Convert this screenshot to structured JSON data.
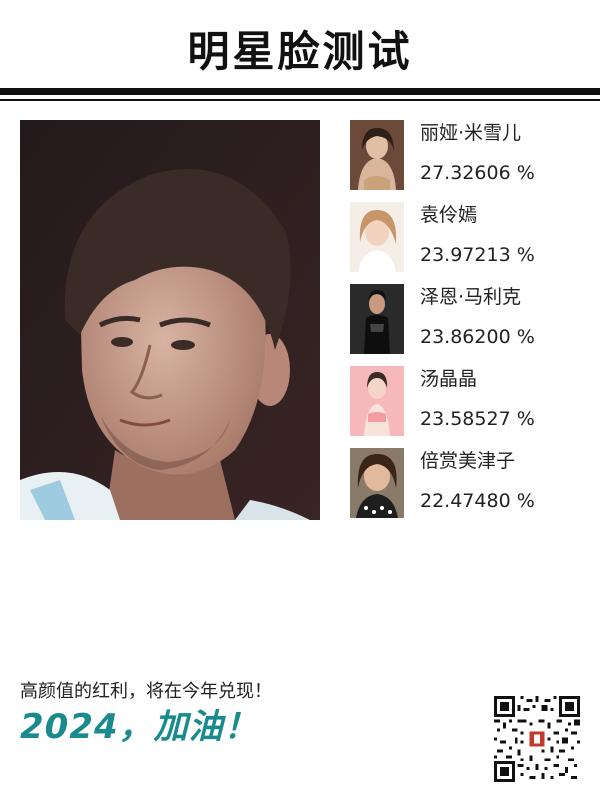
{
  "header": {
    "title": "明星脸测试"
  },
  "main_photo": {
    "icon": "portrait-photo"
  },
  "results": [
    {
      "name": "丽娅·米雪儿",
      "score": "27.32606 %"
    },
    {
      "name": "袁伶嫣",
      "score": "23.97213 %"
    },
    {
      "name": "泽恩·马利克",
      "score": "23.86200 %"
    },
    {
      "name": "汤晶晶",
      "score": "23.58527 %"
    },
    {
      "name": "倍赏美津子",
      "score": "22.47480 %"
    }
  ],
  "footer": {
    "subtitle": "高颜值的红利，将在今年兑现！",
    "slogan": "2024，加油！",
    "slogan_color": "#1a8a8c",
    "qr_icon": "qr-code"
  }
}
